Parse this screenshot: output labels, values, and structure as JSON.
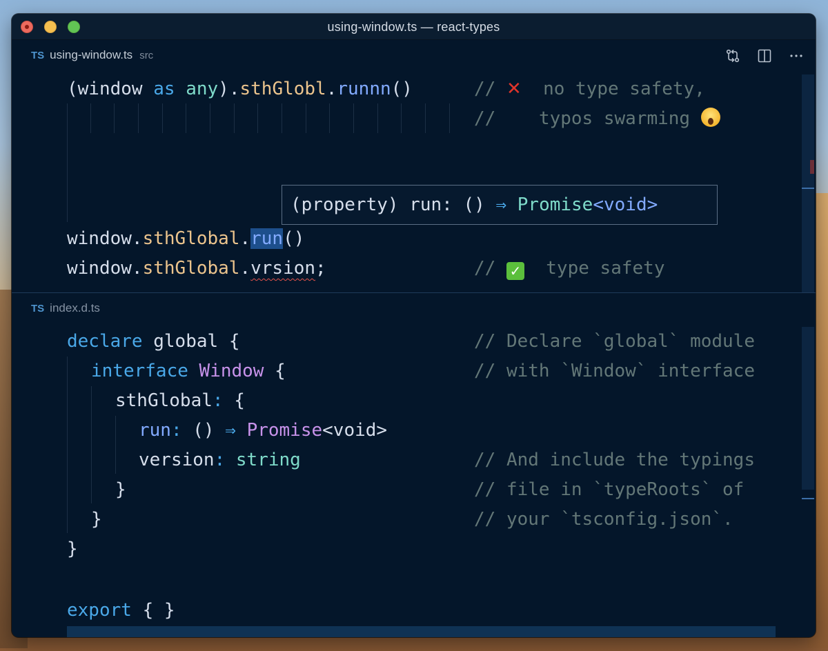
{
  "window": {
    "title": "using-window.ts — react-types"
  },
  "top_pane": {
    "tab": {
      "badge": "TS",
      "filename": "using-window.ts",
      "path": "src"
    },
    "actions": [
      {
        "icon": "compare-changes-icon"
      },
      {
        "icon": "split-editor-icon"
      },
      {
        "icon": "more-icon"
      }
    ],
    "lines": {
      "l1_code_a": "(window ",
      "l1_as": "as",
      "l1_any": " any",
      "l1_paren": ").",
      "l1_prop": "sthGlobl",
      "l1_dot": ".",
      "l1_call": "runnn",
      "l1_parens": "()",
      "l1_comment_prefix": "//",
      "l1_comment_text": "no type safety,",
      "l2_comment_prefix": "//",
      "l2_comment_text": "typos swarming",
      "l3_window": "window",
      "l3_dot1": ".",
      "l3_prop": "sthGlobal",
      "l3_dot2": ".",
      "l3_run": "run",
      "l3_parens": "()",
      "l4_window": "window",
      "l4_dot1": ".",
      "l4_prop": "sthGlobal",
      "l4_dot2": ".",
      "l4_vrsion": "vrsion",
      "l4_semi": ";",
      "l4_comment_prefix": "//",
      "l4_comment_text": "type safety"
    },
    "hover": {
      "open": "(property)",
      "name": " run",
      "colon": ": ",
      "sig": "()",
      "arrow": " ⇒ ",
      "type": "Promise",
      "generic": "<void>"
    }
  },
  "bottom_pane": {
    "tab": {
      "badge": "TS",
      "filename": "index.d.ts"
    },
    "lines": {
      "d1_declare": "declare",
      "d1_global": " global ",
      "d1_brace": "{",
      "d1_comment": "// Declare `global` module",
      "d2_interface": "interface",
      "d2_window": " Window ",
      "d2_brace": "{",
      "d2_comment": "// with `Window` interface",
      "d3_prop": "sthGlobal",
      "d3_colon": ": ",
      "d3_brace": "{",
      "d4_run": "run",
      "d4_colon": ": ",
      "d4_sig": "()",
      "d4_arrow": " ⇒ ",
      "d4_promise": "Promise",
      "d4_generic": "<void>",
      "d5_version": "version",
      "d5_colon": ": ",
      "d5_string": "string",
      "d5_comment": "// And include the typings",
      "d6_close": "}",
      "d6_comment": "// file in `typeRoots` of",
      "d7_close": "}",
      "d7_comment": "// your `tsconfig.json`.",
      "d8_close": "}",
      "d9_export": "export",
      "d9_braces": " { }"
    }
  },
  "colors": {
    "editor_bg": "#04162a",
    "keyword": "#4aa8e8",
    "function": "#82aaff",
    "type": "#c792ea",
    "property": "#ecc48d",
    "comment": "#637777",
    "selection": "#1d4f8c"
  }
}
